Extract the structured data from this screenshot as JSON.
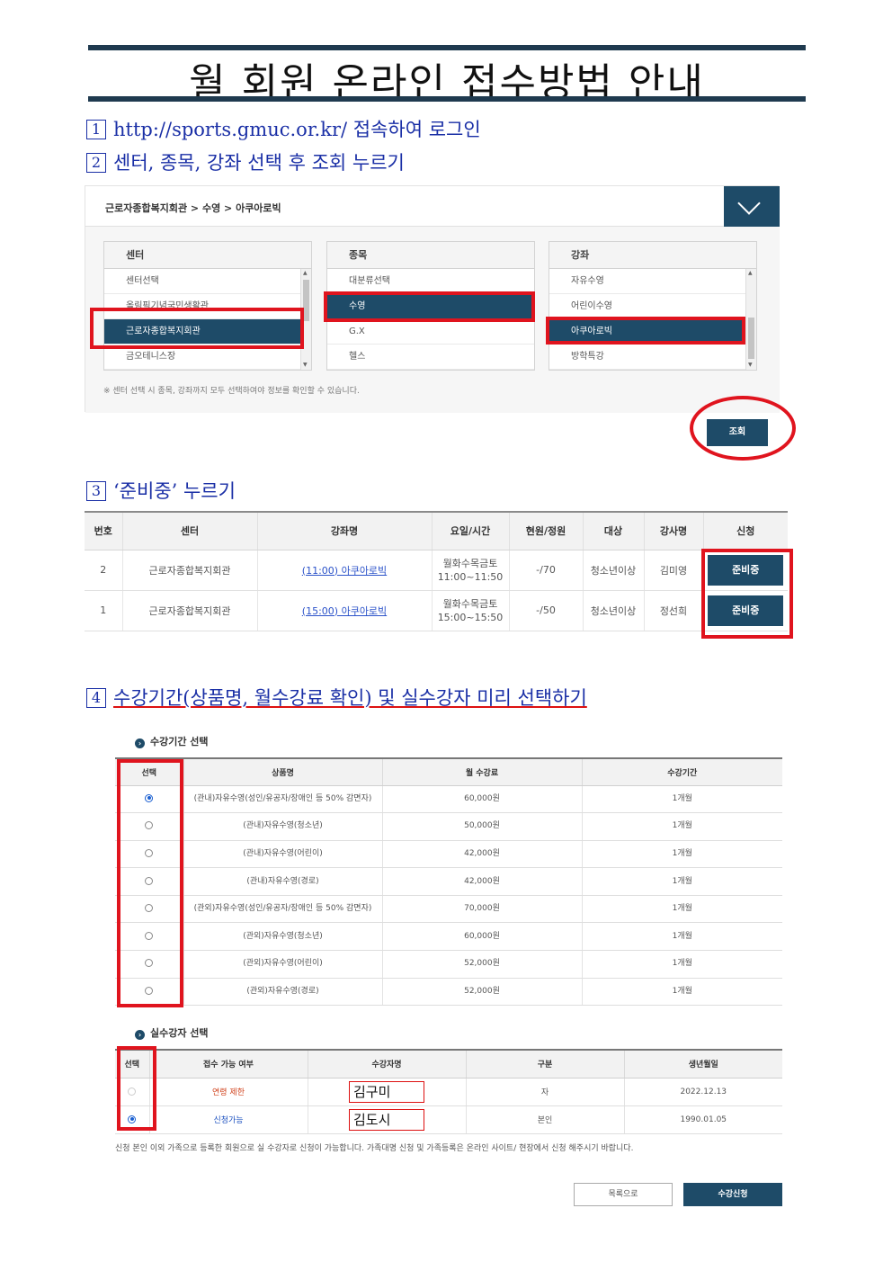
{
  "title": "월 회원 온라인 접수방법 안내",
  "steps": [
    {
      "num": "1",
      "text": "http://sports.gmuc.or.kr/ 접속하여 로그인"
    },
    {
      "num": "2",
      "text": "센터, 종목, 강좌 선택 후 조회 누르기"
    },
    {
      "num": "3",
      "text": "‘준비중’ 누르기"
    },
    {
      "num": "4",
      "text": "수강기간(상품명, 월수강료 확인) 및 실수강자 미리 선택하기"
    }
  ],
  "search_panel": {
    "breadcrumb": "근로자종합복지회관 > 수영 > 아쿠아로빅",
    "center": {
      "header": "센터",
      "items": [
        "센터선택",
        "올림픽기념국민생활관",
        "근로자종합복지회관",
        "금오테니스장"
      ],
      "selected": "근로자종합복지회관"
    },
    "sport": {
      "header": "종목",
      "items": [
        "대분류선택",
        "수영",
        "G.X",
        "헬스"
      ],
      "selected": "수영"
    },
    "course": {
      "header": "강좌",
      "items": [
        "자유수영",
        "어린이수영",
        "아쿠아로빅",
        "방학특강"
      ],
      "selected": "아쿠아로빅"
    },
    "note": "※ 센터 선택 시 종목, 강좌까지 모두 선택하여야 정보를 확인할 수 있습니다.",
    "search_button": "조회"
  },
  "course_table": {
    "headers": [
      "번호",
      "센터",
      "강좌명",
      "요일/시간",
      "현원/정원",
      "대상",
      "강사명",
      "신청"
    ],
    "rows": [
      {
        "no": "2",
        "center": "근로자종합복지회관",
        "course": "(11:00) 아쿠아로빅",
        "days": "월화수목금토",
        "time": "11:00~11:50",
        "capacity": "-/70",
        "target": "청소년이상",
        "instructor": "김미영",
        "action": "준비중"
      },
      {
        "no": "1",
        "center": "근로자종합복지회관",
        "course": "(15:00) 아쿠아로빅",
        "days": "월화수목금토",
        "time": "15:00~15:50",
        "capacity": "-/50",
        "target": "청소년이상",
        "instructor": "정선희",
        "action": "준비중"
      }
    ]
  },
  "period_section": {
    "title": "수강기간 선택",
    "headers": [
      "선택",
      "상품명",
      "월 수강료",
      "수강기간"
    ],
    "rows": [
      {
        "selected": true,
        "product": "(관내)자유수영(성인/유공자/장애인 등 50% 감면자)",
        "fee": "60,000원",
        "period": "1개월"
      },
      {
        "selected": false,
        "product": "(관내)자유수영(청소년)",
        "fee": "50,000원",
        "period": "1개월"
      },
      {
        "selected": false,
        "product": "(관내)자유수영(어린이)",
        "fee": "42,000원",
        "period": "1개월"
      },
      {
        "selected": false,
        "product": "(관내)자유수영(경로)",
        "fee": "42,000원",
        "period": "1개월"
      },
      {
        "selected": false,
        "product": "(관외)자유수영(성인/유공자/장애인 등 50% 감면자)",
        "fee": "70,000원",
        "period": "1개월"
      },
      {
        "selected": false,
        "product": "(관외)자유수영(청소년)",
        "fee": "60,000원",
        "period": "1개월"
      },
      {
        "selected": false,
        "product": "(관외)자유수영(어린이)",
        "fee": "52,000원",
        "period": "1개월"
      },
      {
        "selected": false,
        "product": "(관외)자유수영(경로)",
        "fee": "52,000원",
        "period": "1개월"
      }
    ]
  },
  "student_section": {
    "title": "실수강자 선택",
    "headers": [
      "선택",
      "접수 가능 여부",
      "수강자명",
      "구분",
      "생년월일"
    ],
    "rows": [
      {
        "selected": false,
        "status": "연령 제한",
        "name": "김구미",
        "relation": "자",
        "birth": "2022.12.13"
      },
      {
        "selected": true,
        "status": "신청가능",
        "name": "김도시",
        "relation": "본인",
        "birth": "1990.01.05"
      }
    ]
  },
  "footer_note": "신청 본인 이외 가족으로 등록한 회원으로 실 수강자로 신청이 가능합니다. 가족대명 신청 및 가족등록은 온라인 사이트/ 현장에서 신청 해주시기 바랍니다.",
  "buttons": {
    "list": "목록으로",
    "apply": "수강신청"
  }
}
